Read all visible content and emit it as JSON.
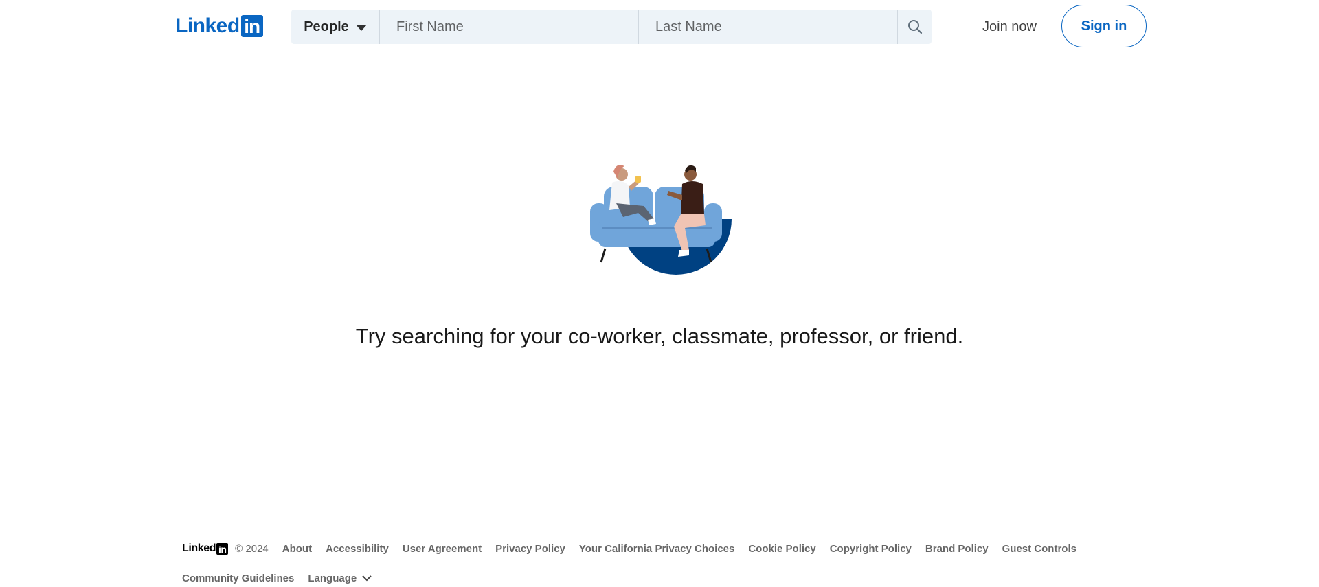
{
  "header": {
    "logo_text": "Linked",
    "logo_box": "in",
    "search": {
      "type_label": "People",
      "first_name_placeholder": "First Name",
      "last_name_placeholder": "Last Name"
    },
    "join_now_label": "Join now",
    "sign_in_label": "Sign in"
  },
  "main": {
    "illustration_icon": "people-on-couch-illustration",
    "message": "Try searching for your co-worker, classmate, professor, or friend."
  },
  "footer": {
    "logo_text": "Linked",
    "logo_box": "in",
    "copyright": "© 2024",
    "links": [
      "About",
      "Accessibility",
      "User Agreement",
      "Privacy Policy",
      "Your California Privacy Choices",
      "Cookie Policy",
      "Copyright Policy",
      "Brand Policy",
      "Guest Controls",
      "Community Guidelines"
    ],
    "language_label": "Language"
  },
  "colors": {
    "brand": "#0a66c2",
    "search_bg": "#edf3f8",
    "couch": "#70a5da",
    "circle": "#004182"
  }
}
